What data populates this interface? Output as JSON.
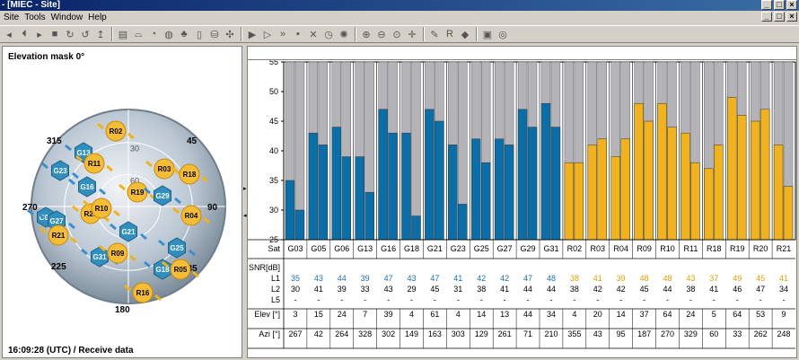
{
  "window": {
    "title": "- [MIEC - Site]",
    "buttons": [
      "_",
      "□",
      "×"
    ]
  },
  "menubar": {
    "items": [
      "Site",
      "Tools",
      "Window",
      "Help"
    ]
  },
  "toolbar": {
    "groups": [
      [
        "play-back-icon",
        "step-back-icon",
        "play-icon",
        "stop-icon",
        "reload-icon",
        "reload-alt-icon",
        "marker-icon"
      ],
      [
        "book-icon",
        "antenna-icon",
        "chart-icon",
        "globe-icon",
        "tree-icon",
        "doc-icon",
        "db-icon",
        "satellite-icon"
      ],
      [
        "play-arrow-icon",
        "play-outline-icon",
        "fast-forward-icon",
        "square-icon",
        "tools-icon",
        "clock-icon",
        "gear-icon"
      ],
      [
        "zoom-in-icon",
        "zoom-out-icon",
        "zoom-fit-icon",
        "crosshair-icon"
      ],
      [
        "wand-icon",
        "r-icon",
        "config-icon"
      ],
      [
        "window-icon",
        "target-icon"
      ]
    ],
    "active_index": 5
  },
  "left": {
    "elevation_mask_label": "Elevation mask  0°",
    "status": "16:09:28 (UTC) / Receive data",
    "azimuth_labels": [
      "315",
      "45",
      "90",
      "270",
      "225",
      "180",
      "135"
    ],
    "elevation_rings": [
      "30",
      "60"
    ],
    "satellites": [
      {
        "id": "R02",
        "sys": "R"
      },
      {
        "id": "G13",
        "sys": "G"
      },
      {
        "id": "R11",
        "sys": "R"
      },
      {
        "id": "G23",
        "sys": "G"
      },
      {
        "id": "R03",
        "sys": "R"
      },
      {
        "id": "R18",
        "sys": "R"
      },
      {
        "id": "G16",
        "sys": "G"
      },
      {
        "id": "R19",
        "sys": "R"
      },
      {
        "id": "G29",
        "sys": "G"
      },
      {
        "id": "R20",
        "sys": "R"
      },
      {
        "id": "R10",
        "sys": "R"
      },
      {
        "id": "G06",
        "sys": "G"
      },
      {
        "id": "G27",
        "sys": "G"
      },
      {
        "id": "R04",
        "sys": "R"
      },
      {
        "id": "R21",
        "sys": "R"
      },
      {
        "id": "G21",
        "sys": "G"
      },
      {
        "id": "G31",
        "sys": "G"
      },
      {
        "id": "R09",
        "sys": "R"
      },
      {
        "id": "G25",
        "sys": "G"
      },
      {
        "id": "G18",
        "sys": "G"
      },
      {
        "id": "R05",
        "sys": "R"
      },
      {
        "id": "R16",
        "sys": "R"
      }
    ]
  },
  "chart_data": {
    "type": "bar",
    "ylabel": "SNR[dB]",
    "ylim": [
      25,
      55
    ],
    "yticks": [
      25,
      30,
      35,
      40,
      45,
      50,
      55
    ],
    "categories": [
      "G03",
      "G05",
      "G06",
      "G13",
      "G16",
      "G18",
      "G21",
      "G23",
      "G25",
      "G27",
      "G29",
      "G31",
      "R02",
      "R03",
      "R04",
      "R09",
      "R10",
      "R11",
      "R18",
      "R19",
      "R20",
      "R21"
    ],
    "series": [
      {
        "name": "L1",
        "values": [
          35,
          43,
          44,
          39,
          47,
          43,
          47,
          41,
          42,
          42,
          47,
          48,
          38,
          41,
          39,
          48,
          48,
          43,
          37,
          49,
          45,
          41
        ]
      },
      {
        "name": "L2",
        "values": [
          30,
          41,
          39,
          33,
          43,
          29,
          45,
          31,
          38,
          41,
          44,
          44,
          38,
          42,
          42,
          45,
          44,
          38,
          41,
          46,
          47,
          34
        ]
      }
    ],
    "colors": {
      "G": "#0a6fa8",
      "R": "#f2b21c",
      "bg": "#b3b3b8"
    },
    "rows": {
      "sat_label": "Sat",
      "snr_label": "SNR[dB]",
      "l1_label": "L1",
      "l2_label": "L2",
      "l5_label": "L5",
      "l5_values": [
        "-",
        "-",
        "-",
        "-",
        "-",
        "-",
        "-",
        "-",
        "-",
        "-",
        "-",
        "-",
        "-",
        "-",
        "-",
        "-",
        "-",
        "-",
        "-",
        "-",
        "-",
        "-"
      ],
      "elev_label": "Elev [°]",
      "elev": [
        3,
        15,
        24,
        7,
        39,
        4,
        61,
        4,
        14,
        13,
        44,
        34,
        4,
        20,
        14,
        37,
        64,
        24,
        5,
        64,
        53,
        9
      ],
      "azi_label": "Azi [°]",
      "azi": [
        267,
        42,
        264,
        328,
        302,
        149,
        163,
        303,
        129,
        261,
        71,
        210,
        355,
        43,
        95,
        187,
        270,
        329,
        60,
        33,
        262,
        248
      ]
    }
  }
}
